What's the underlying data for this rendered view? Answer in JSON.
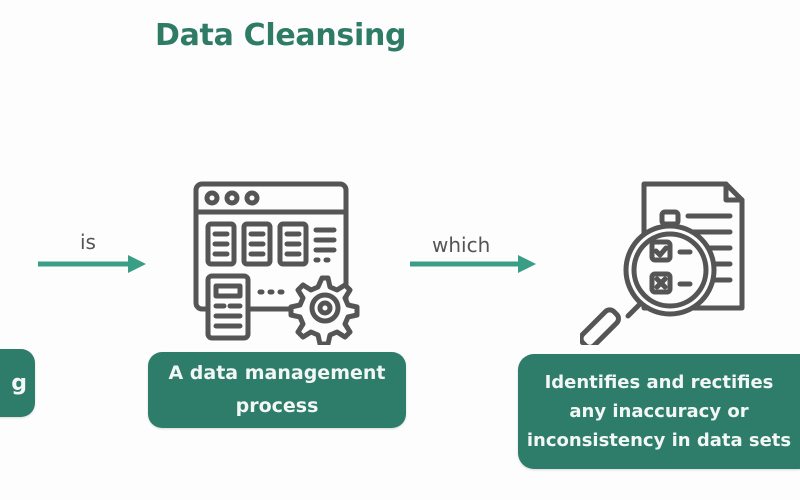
{
  "title": "Data Cleansing",
  "colors": {
    "accent": "#2e7d6b",
    "title": "#2e7c66",
    "arrow": "#3a9e86",
    "icon_stroke": "#555555",
    "box_text": "#f2f7f5"
  },
  "connectors": [
    {
      "label": "is",
      "icon": "arrow-right-icon"
    },
    {
      "label": "which",
      "icon": "arrow-right-icon"
    }
  ],
  "boxes": {
    "left": {
      "text": "g"
    },
    "middle": {
      "lines": [
        "A data management",
        "process"
      ]
    },
    "right": {
      "lines": [
        "Identifies and rectifies",
        "any inaccuracy or",
        "inconsistency in data sets"
      ]
    }
  },
  "icons": {
    "middle": "data-management-window-gear-icon",
    "right": "document-magnifier-checklist-icon"
  }
}
